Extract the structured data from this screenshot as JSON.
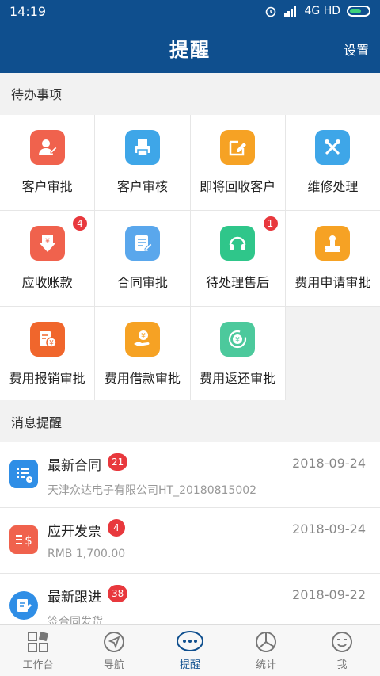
{
  "status_bar": {
    "time": "14:19",
    "network": "4G HD"
  },
  "header": {
    "title": "提醒",
    "settings": "设置"
  },
  "todo": {
    "section_title": "待办事项",
    "items": [
      {
        "label": "客户审批",
        "icon": "user-approve-icon",
        "color": "#f0624d",
        "badge": ""
      },
      {
        "label": "客户审核",
        "icon": "printer-icon",
        "color": "#3ea6e8",
        "badge": ""
      },
      {
        "label": "即将回收客户",
        "icon": "edit-note-icon",
        "color": "#f6a224",
        "badge": ""
      },
      {
        "label": "维修处理",
        "icon": "tools-icon",
        "color": "#3ea6e8",
        "badge": ""
      },
      {
        "label": "应收账款",
        "icon": "yuan-download-icon",
        "color": "#f0624d",
        "badge": "4"
      },
      {
        "label": "合同审批",
        "icon": "document-edit-icon",
        "color": "#5aa7ec",
        "badge": ""
      },
      {
        "label": "待处理售后",
        "icon": "headset-icon",
        "color": "#2fc68a",
        "badge": "1"
      },
      {
        "label": "费用申请审批",
        "icon": "stamp-icon",
        "color": "#f6a224",
        "badge": ""
      },
      {
        "label": "费用报销审批",
        "icon": "yuan-receipt-icon",
        "color": "#f0662c",
        "badge": ""
      },
      {
        "label": "费用借款审批",
        "icon": "hand-coin-icon",
        "color": "#f6a224",
        "badge": ""
      },
      {
        "label": "费用返还审批",
        "icon": "yuan-refund-icon",
        "color": "#4cc99c",
        "badge": ""
      }
    ]
  },
  "messages": {
    "section_title": "消息提醒",
    "items": [
      {
        "title": "最新合同",
        "badge": "21",
        "date": "2018-09-24",
        "desc": "天津众达电子有限公司HT_20180815002",
        "icon": "contract-list-icon",
        "color": "#2f8ee6"
      },
      {
        "title": "应开发票",
        "badge": "4",
        "date": "2018-09-24",
        "desc": "RMB 1,700.00",
        "icon": "invoice-dollar-icon",
        "color": "#f0624d"
      },
      {
        "title": "最新跟进",
        "badge": "38",
        "date": "2018-09-22",
        "desc": "签合同发货",
        "icon": "followup-note-icon",
        "color": "#2f8ee6"
      }
    ]
  },
  "tabbar": {
    "items": [
      {
        "label": "工作台",
        "icon": "grid-icon"
      },
      {
        "label": "导航",
        "icon": "navigation-icon"
      },
      {
        "label": "提醒",
        "icon": "chat-dots-icon",
        "active": true
      },
      {
        "label": "统计",
        "icon": "pie-chart-icon"
      },
      {
        "label": "我",
        "icon": "smiley-icon"
      }
    ]
  }
}
